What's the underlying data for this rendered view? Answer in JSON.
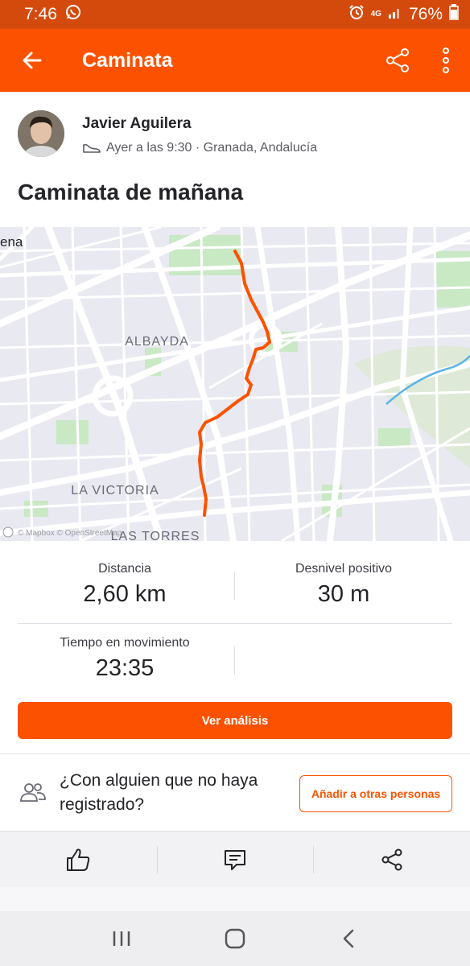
{
  "status_bar": {
    "time": "7:46",
    "network": "4G",
    "battery": "76%"
  },
  "app_bar": {
    "title": "Caminata"
  },
  "activity": {
    "athlete_name": "Javier Aguilera",
    "meta": "Ayer a las 9:30 · Granada, Andalucía",
    "title": "Caminata de mañana"
  },
  "map": {
    "labels": {
      "albayda": "ALBAYDA",
      "la_victoria": "LA VICTORIA",
      "las_torres": "LAS TORRES",
      "edge_label": "ena"
    },
    "attribution": "© Mapbox © OpenStreetMap",
    "route_color": "#fc5200"
  },
  "stats": {
    "distance_label": "Distancia",
    "distance_value": "2,60 km",
    "elevation_label": "Desnivel positivo",
    "elevation_value": "30 m",
    "moving_time_label": "Tiempo en movimiento",
    "moving_time_value": "23:35",
    "analysis_button": "Ver análisis"
  },
  "group_prompt": {
    "text": "¿Con alguien que no haya registrado?",
    "button": "Añadir a otras personas"
  },
  "colors": {
    "brand": "#fc5200",
    "status_bar": "#d44a0d"
  }
}
